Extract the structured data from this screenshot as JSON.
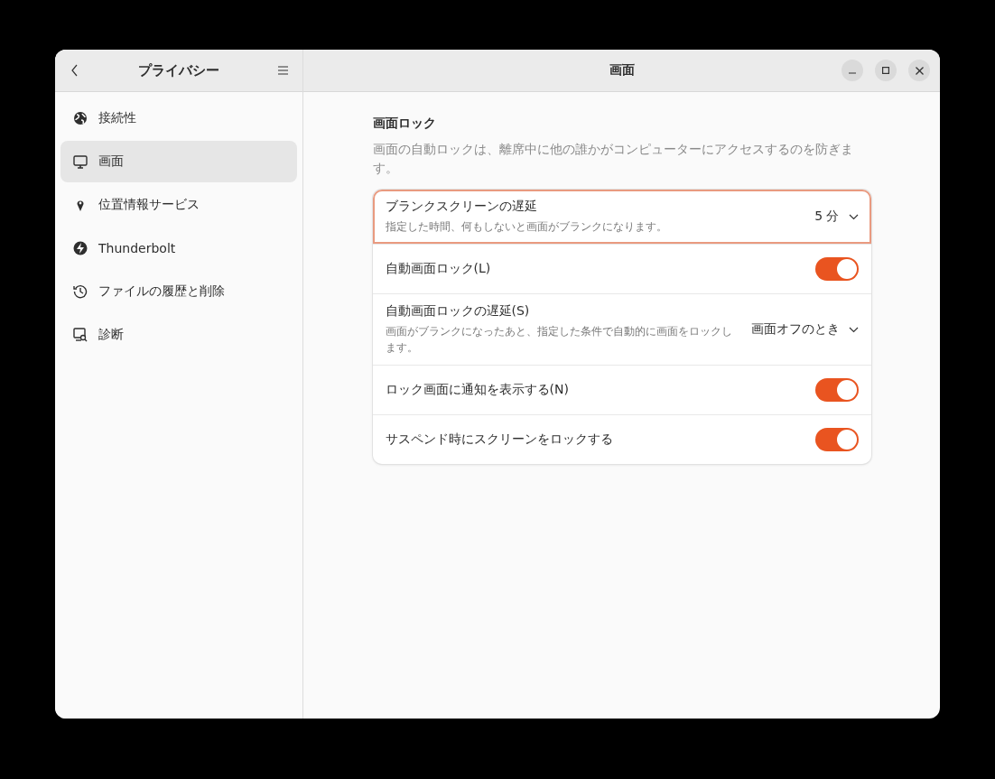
{
  "sidebar": {
    "title": "プライバシー",
    "items": [
      {
        "label": "接続性",
        "selected": false
      },
      {
        "label": "画面",
        "selected": true
      },
      {
        "label": "位置情報サービス",
        "selected": false
      },
      {
        "label": "Thunderbolt",
        "selected": false
      },
      {
        "label": "ファイルの履歴と削除",
        "selected": false
      },
      {
        "label": "診断",
        "selected": false
      }
    ]
  },
  "window": {
    "title": "画面"
  },
  "section": {
    "title": "画面ロック",
    "description": "画面の自動ロックは、離席中に他の誰かがコンピューターにアクセスするのを防ぎます。",
    "rows": [
      {
        "kind": "dropdown",
        "label": "ブランクスクリーンの遅延",
        "subtitle": "指定した時間、何もしないと画面がブランクになります。",
        "value": "5 分",
        "focused": true
      },
      {
        "kind": "switch",
        "label": "自動画面ロック(L)",
        "on": true,
        "focused": false
      },
      {
        "kind": "dropdown",
        "label": "自動画面ロックの遅延(S)",
        "subtitle": "画面がブランクになったあと、指定した条件で自動的に画面をロックします。",
        "value": "画面オフのとき",
        "focused": false
      },
      {
        "kind": "switch",
        "label": "ロック画面に通知を表示する(N)",
        "on": true,
        "focused": false
      },
      {
        "kind": "switch",
        "label": "サスペンド時にスクリーンをロックする",
        "on": true,
        "focused": false
      }
    ]
  }
}
